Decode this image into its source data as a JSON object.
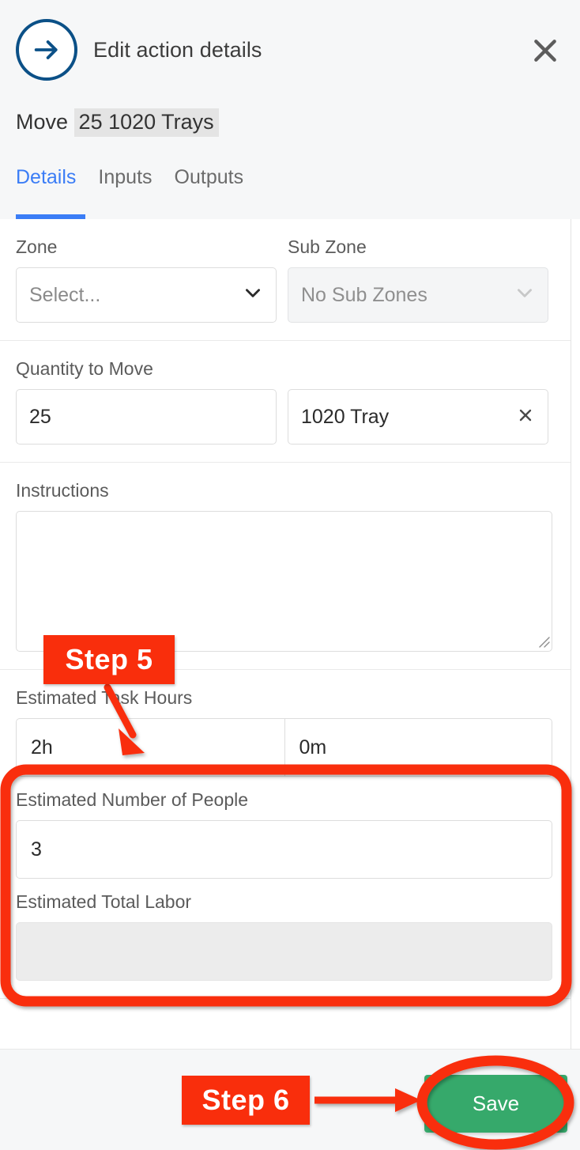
{
  "header": {
    "back_icon": "arrow-right-circle-icon",
    "title": "Edit action details",
    "close_icon": "close-icon",
    "subtitle_prefix": "Move",
    "subtitle_highlight": "25 1020 Trays",
    "tabs": [
      {
        "label": "Details",
        "active": true
      },
      {
        "label": "Inputs",
        "active": false
      },
      {
        "label": "Outputs",
        "active": false
      }
    ]
  },
  "form": {
    "zone": {
      "label": "Zone",
      "value": "Select...",
      "chevron_icon": "chevron-down-icon",
      "disabled": false
    },
    "sub_zone": {
      "label": "Sub Zone",
      "value": "No Sub Zones",
      "chevron_icon": "chevron-down-icon",
      "disabled": true
    },
    "quantity": {
      "label": "Quantity to Move",
      "amount": "25",
      "unit": "1020 Tray",
      "clear_icon": "clear-x-icon"
    },
    "instructions": {
      "label": "Instructions",
      "value": "",
      "placeholder": "",
      "resize_icon": "resize-handle-icon"
    },
    "task_hours": {
      "label": "Estimated Task Hours",
      "hours": "2h",
      "minutes": "0m"
    },
    "people": {
      "label": "Estimated Number of People",
      "value": "3"
    },
    "total_labor": {
      "label": "Estimated Total Labor",
      "value": ""
    }
  },
  "footer": {
    "save_label": "Save"
  },
  "annotations": {
    "step5": {
      "label": "Step 5"
    },
    "step6": {
      "label": "Step 6"
    },
    "highlight_color": "#f92e0c",
    "save_accent": "#36a96b"
  }
}
